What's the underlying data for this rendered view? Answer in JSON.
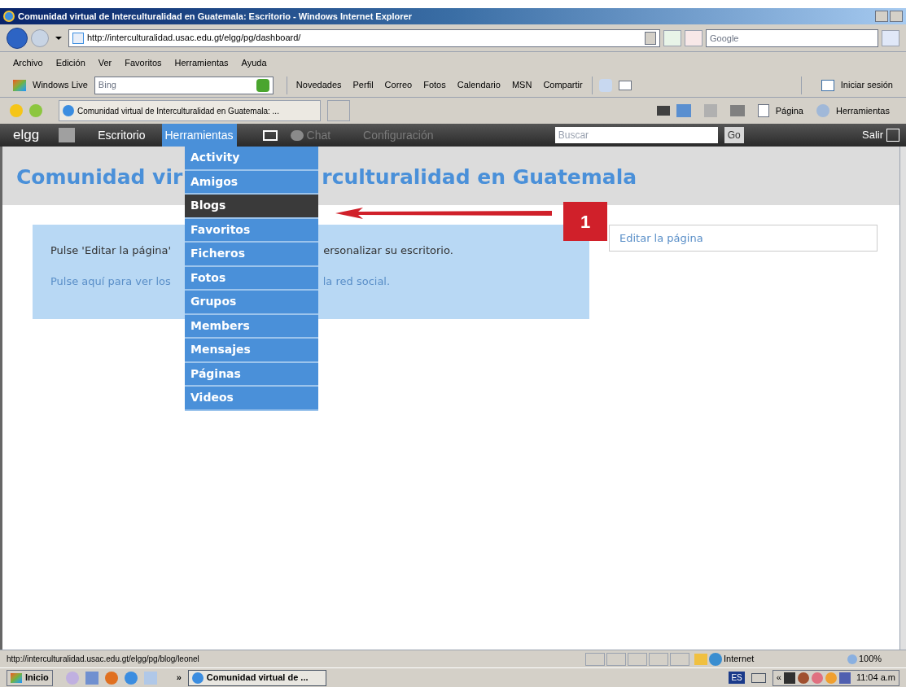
{
  "window": {
    "title": "Comunidad virtual de Interculturalidad en Guatemala: Escritorio - Windows Internet Explorer"
  },
  "address_bar": {
    "url": "http://interculturalidad.usac.edu.gt/elgg/pg/dashboard/",
    "search_placeholder": "Google"
  },
  "menu_bar": [
    "Archivo",
    "Edición",
    "Ver",
    "Favoritos",
    "Herramientas",
    "Ayuda"
  ],
  "links_toolbar": {
    "brand": "Windows Live",
    "search_placeholder": "Bing",
    "links": [
      "Novedades",
      "Perfil",
      "Correo",
      "Fotos",
      "Calendario",
      "MSN",
      "Compartir"
    ],
    "sign_in": "Iniciar sesión"
  },
  "tab": {
    "label": "Comunidad virtual de Interculturalidad en Guatemala: ..."
  },
  "command_bar": [
    "Página",
    "Herramientas"
  ],
  "elgg_bar": {
    "logo": "elgg",
    "items": [
      {
        "label": "Escritorio",
        "selected": false,
        "disabled": false
      },
      {
        "label": "Herramientas",
        "selected": true,
        "disabled": false
      },
      {
        "label": "Chat",
        "selected": false,
        "disabled": true
      },
      {
        "label": "Configuración",
        "selected": false,
        "disabled": true
      }
    ],
    "search_placeholder": "Buscar",
    "go": "Go",
    "logout": "Salir"
  },
  "page": {
    "title_parts": [
      "Comunidad vir",
      "rculturalidad en Guatemala"
    ],
    "message_parts": [
      "Pulse 'Editar la página'",
      "ersonalizar su escritorio."
    ],
    "link_parts": [
      "Pulse aquí para ver los",
      "la red social."
    ],
    "edit_link": "Editar la página"
  },
  "dropdown": [
    {
      "label": "Activity",
      "selected": false
    },
    {
      "label": "Amigos",
      "selected": false
    },
    {
      "label": "Blogs",
      "selected": true
    },
    {
      "label": "Favoritos",
      "selected": false
    },
    {
      "label": "Ficheros",
      "selected": false
    },
    {
      "label": "Fotos",
      "selected": false
    },
    {
      "label": "Grupos",
      "selected": false
    },
    {
      "label": "Members",
      "selected": false
    },
    {
      "label": "Mensajes",
      "selected": false
    },
    {
      "label": "Páginas",
      "selected": false
    },
    {
      "label": "Videos",
      "selected": false
    }
  ],
  "annotation": {
    "number": "1"
  },
  "status_bar": {
    "url": "http://interculturalidad.usac.edu.gt/elgg/pg/blog/leonel",
    "zone": "Internet",
    "zoom": "100%"
  },
  "taskbar": {
    "start": "Inicio",
    "chevron": "»",
    "window": "Comunidad virtual de ...",
    "language": "ES",
    "tray_chevron": "«",
    "clock": "11:04 a.m"
  }
}
